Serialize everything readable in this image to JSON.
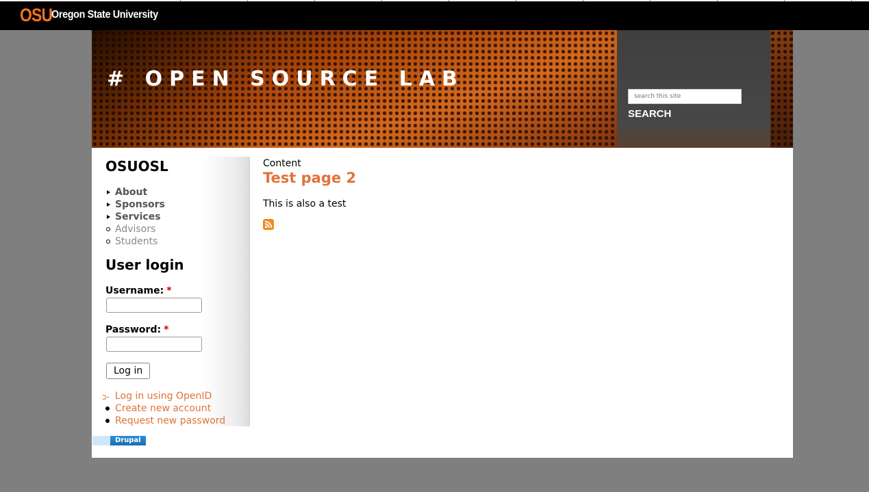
{
  "osu_bar": {
    "logo_mark": "OSU",
    "logo_text": "Oregon State University"
  },
  "header": {
    "site_title": "# OPEN SOURCE LAB",
    "search_placeholder": "search this site",
    "search_label": "SEARCH"
  },
  "sidebar": {
    "title": "OSUOSL",
    "menu": [
      {
        "label": "About",
        "expanded": true
      },
      {
        "label": "Sponsors",
        "expanded": true
      },
      {
        "label": "Services",
        "expanded": true
      },
      {
        "label": "Advisors",
        "expanded": false
      },
      {
        "label": "Students",
        "expanded": false
      }
    ]
  },
  "login": {
    "title": "User login",
    "username_label": "Username:",
    "password_label": "Password:",
    "required_mark": "*",
    "submit_label": "Log in",
    "links": [
      "Log in using OpenID",
      "Create new account",
      "Request new password"
    ]
  },
  "content": {
    "label": "Content",
    "title": "Test page 2",
    "body": "This is also a test"
  },
  "footer": {
    "badge_text": "Drupal"
  },
  "colors": {
    "accent": "#e0733a",
    "osu_orange": "#f47321"
  }
}
